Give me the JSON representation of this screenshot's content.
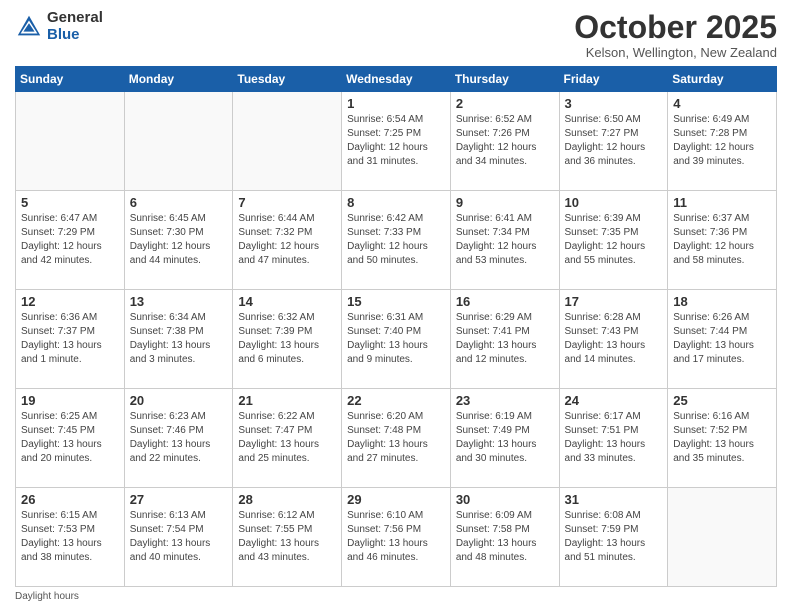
{
  "logo": {
    "general": "General",
    "blue": "Blue"
  },
  "header": {
    "month": "October 2025",
    "location": "Kelson, Wellington, New Zealand"
  },
  "days_of_week": [
    "Sunday",
    "Monday",
    "Tuesday",
    "Wednesday",
    "Thursday",
    "Friday",
    "Saturday"
  ],
  "footer": {
    "daylight_label": "Daylight hours"
  },
  "weeks": [
    [
      {
        "day": "",
        "info": ""
      },
      {
        "day": "",
        "info": ""
      },
      {
        "day": "",
        "info": ""
      },
      {
        "day": "1",
        "info": "Sunrise: 6:54 AM\nSunset: 7:25 PM\nDaylight: 12 hours\nand 31 minutes."
      },
      {
        "day": "2",
        "info": "Sunrise: 6:52 AM\nSunset: 7:26 PM\nDaylight: 12 hours\nand 34 minutes."
      },
      {
        "day": "3",
        "info": "Sunrise: 6:50 AM\nSunset: 7:27 PM\nDaylight: 12 hours\nand 36 minutes."
      },
      {
        "day": "4",
        "info": "Sunrise: 6:49 AM\nSunset: 7:28 PM\nDaylight: 12 hours\nand 39 minutes."
      }
    ],
    [
      {
        "day": "5",
        "info": "Sunrise: 6:47 AM\nSunset: 7:29 PM\nDaylight: 12 hours\nand 42 minutes."
      },
      {
        "day": "6",
        "info": "Sunrise: 6:45 AM\nSunset: 7:30 PM\nDaylight: 12 hours\nand 44 minutes."
      },
      {
        "day": "7",
        "info": "Sunrise: 6:44 AM\nSunset: 7:32 PM\nDaylight: 12 hours\nand 47 minutes."
      },
      {
        "day": "8",
        "info": "Sunrise: 6:42 AM\nSunset: 7:33 PM\nDaylight: 12 hours\nand 50 minutes."
      },
      {
        "day": "9",
        "info": "Sunrise: 6:41 AM\nSunset: 7:34 PM\nDaylight: 12 hours\nand 53 minutes."
      },
      {
        "day": "10",
        "info": "Sunrise: 6:39 AM\nSunset: 7:35 PM\nDaylight: 12 hours\nand 55 minutes."
      },
      {
        "day": "11",
        "info": "Sunrise: 6:37 AM\nSunset: 7:36 PM\nDaylight: 12 hours\nand 58 minutes."
      }
    ],
    [
      {
        "day": "12",
        "info": "Sunrise: 6:36 AM\nSunset: 7:37 PM\nDaylight: 13 hours\nand 1 minute."
      },
      {
        "day": "13",
        "info": "Sunrise: 6:34 AM\nSunset: 7:38 PM\nDaylight: 13 hours\nand 3 minutes."
      },
      {
        "day": "14",
        "info": "Sunrise: 6:32 AM\nSunset: 7:39 PM\nDaylight: 13 hours\nand 6 minutes."
      },
      {
        "day": "15",
        "info": "Sunrise: 6:31 AM\nSunset: 7:40 PM\nDaylight: 13 hours\nand 9 minutes."
      },
      {
        "day": "16",
        "info": "Sunrise: 6:29 AM\nSunset: 7:41 PM\nDaylight: 13 hours\nand 12 minutes."
      },
      {
        "day": "17",
        "info": "Sunrise: 6:28 AM\nSunset: 7:43 PM\nDaylight: 13 hours\nand 14 minutes."
      },
      {
        "day": "18",
        "info": "Sunrise: 6:26 AM\nSunset: 7:44 PM\nDaylight: 13 hours\nand 17 minutes."
      }
    ],
    [
      {
        "day": "19",
        "info": "Sunrise: 6:25 AM\nSunset: 7:45 PM\nDaylight: 13 hours\nand 20 minutes."
      },
      {
        "day": "20",
        "info": "Sunrise: 6:23 AM\nSunset: 7:46 PM\nDaylight: 13 hours\nand 22 minutes."
      },
      {
        "day": "21",
        "info": "Sunrise: 6:22 AM\nSunset: 7:47 PM\nDaylight: 13 hours\nand 25 minutes."
      },
      {
        "day": "22",
        "info": "Sunrise: 6:20 AM\nSunset: 7:48 PM\nDaylight: 13 hours\nand 27 minutes."
      },
      {
        "day": "23",
        "info": "Sunrise: 6:19 AM\nSunset: 7:49 PM\nDaylight: 13 hours\nand 30 minutes."
      },
      {
        "day": "24",
        "info": "Sunrise: 6:17 AM\nSunset: 7:51 PM\nDaylight: 13 hours\nand 33 minutes."
      },
      {
        "day": "25",
        "info": "Sunrise: 6:16 AM\nSunset: 7:52 PM\nDaylight: 13 hours\nand 35 minutes."
      }
    ],
    [
      {
        "day": "26",
        "info": "Sunrise: 6:15 AM\nSunset: 7:53 PM\nDaylight: 13 hours\nand 38 minutes."
      },
      {
        "day": "27",
        "info": "Sunrise: 6:13 AM\nSunset: 7:54 PM\nDaylight: 13 hours\nand 40 minutes."
      },
      {
        "day": "28",
        "info": "Sunrise: 6:12 AM\nSunset: 7:55 PM\nDaylight: 13 hours\nand 43 minutes."
      },
      {
        "day": "29",
        "info": "Sunrise: 6:10 AM\nSunset: 7:56 PM\nDaylight: 13 hours\nand 46 minutes."
      },
      {
        "day": "30",
        "info": "Sunrise: 6:09 AM\nSunset: 7:58 PM\nDaylight: 13 hours\nand 48 minutes."
      },
      {
        "day": "31",
        "info": "Sunrise: 6:08 AM\nSunset: 7:59 PM\nDaylight: 13 hours\nand 51 minutes."
      },
      {
        "day": "",
        "info": ""
      }
    ]
  ]
}
